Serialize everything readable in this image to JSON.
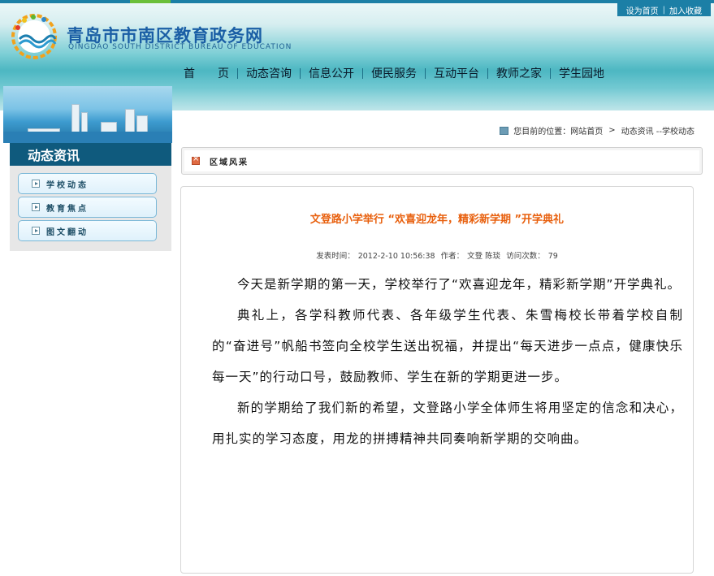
{
  "header": {
    "site_title": "青岛市市南区教育政务网",
    "site_subtitle": "QINGDAO SOUTH DISTRICT BUREAU OF EDUCATION",
    "top_links": [
      "设为首页",
      "加入收藏"
    ]
  },
  "nav": {
    "items": [
      "首　　页",
      "动态咨询",
      "信息公开",
      "便民服务",
      "互动平台",
      "教师之家",
      "学生园地"
    ]
  },
  "sidebar": {
    "title": "动态资讯",
    "items": [
      "学校动态",
      "教育焦点",
      "图文翻动"
    ]
  },
  "location": {
    "prefix": "您目前的位置：",
    "home": "网站首页",
    "separator": ">",
    "current": "动态资讯 --学校动态"
  },
  "section": {
    "label": "区域风采"
  },
  "article": {
    "title": "文登路小学举行 “欢喜迎龙年，精彩新学期 ”开学典礼",
    "meta": {
      "published_label": "发表时间：",
      "published": "2012-2-10 10:56:38",
      "author_label": "作者：",
      "author": "文登  陈琰",
      "views_label": "访问次数：",
      "views": "79"
    },
    "paragraphs": [
      "今天是新学期的第一天，学校举行了“欢喜迎龙年，精彩新学期”开学典礼。",
      "典礼上，各学科教师代表、各年级学生代表、朱雪梅校长带着学校自制的“奋进号”帆船书签向全校学生送出祝福，并提出“每天进步一点点，健康快乐每一天”的行动口号，鼓励教师、学生在新的学期更进一步。",
      "新的学期给了我们新的希望，文登路小学全体师生将用坚定的信念和决心，用扎实的学习态度，用龙的拼搏精神共同奏响新学期的交响曲。"
    ]
  },
  "icons": {
    "logo": "bureau-logo-icon",
    "location": "location-icon",
    "section": "section-icon",
    "arrow": "arrow-right-icon"
  },
  "colors": {
    "brand_blue": "#1a5ea5",
    "title_orange": "#e8600e",
    "sidebar_header": "#0f5a7d"
  }
}
